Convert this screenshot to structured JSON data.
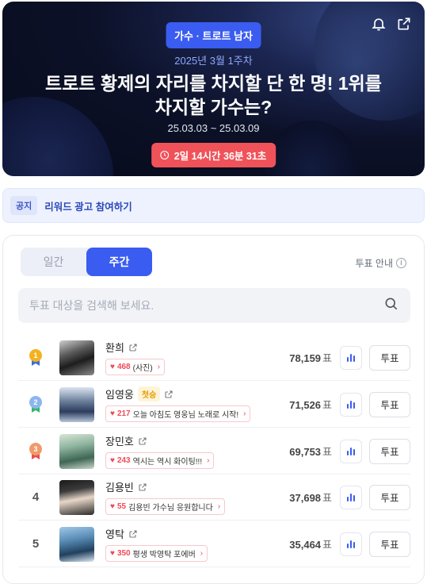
{
  "hero": {
    "category": "가수 · 트로트 남자",
    "week": "2025년 3월 1주차",
    "title_line1": "트로트 황제의 자리를 차지할 단 한 명! 1위를",
    "title_line2": "차지할 가수는?",
    "period": "25.03.03 ~ 25.03.09",
    "countdown": "2일 14시간 36분 31초",
    "icons": [
      "bell-icon",
      "share-icon",
      "clock-icon"
    ]
  },
  "notice": {
    "tag": "공지",
    "text": "리워드 광고 참여하기"
  },
  "tabs": [
    {
      "label": "일간",
      "active": false
    },
    {
      "label": "주간",
      "active": true
    }
  ],
  "vote_guide": "투표 안내",
  "search": {
    "placeholder": "투표 대상을 검색해 보세요.",
    "value": ""
  },
  "vote_unit": "표",
  "vote_button": "투표",
  "colors": {
    "accent": "#3a5cf0",
    "countdown": "#f0525a",
    "heart": "#ef4a56",
    "gold": "#f3b321",
    "silver": "#8db6ef",
    "bronze": "#f09a6a"
  },
  "rankings": [
    {
      "rank": "1",
      "medal": "gold",
      "name": "환희",
      "badge": "",
      "cheer_count": "468",
      "cheer_text": "(사진)",
      "votes": "78,159"
    },
    {
      "rank": "2",
      "medal": "silver",
      "name": "임영웅",
      "badge": "첫승",
      "cheer_count": "217",
      "cheer_text": "오늘 아침도 영웅님 노래로 시작!",
      "votes": "71,526"
    },
    {
      "rank": "3",
      "medal": "bronze",
      "name": "장민호",
      "badge": "",
      "cheer_count": "243",
      "cheer_text": "역시는 역시 화이팅!!!",
      "votes": "69,753"
    },
    {
      "rank": "4",
      "medal": "",
      "name": "김용빈",
      "badge": "",
      "cheer_count": "55",
      "cheer_text": "김용빈 가수님 응원합니다",
      "votes": "37,698"
    },
    {
      "rank": "5",
      "medal": "",
      "name": "영탁",
      "badge": "",
      "cheer_count": "350",
      "cheer_text": "평생 박영탁 포에버",
      "votes": "35,464"
    }
  ]
}
